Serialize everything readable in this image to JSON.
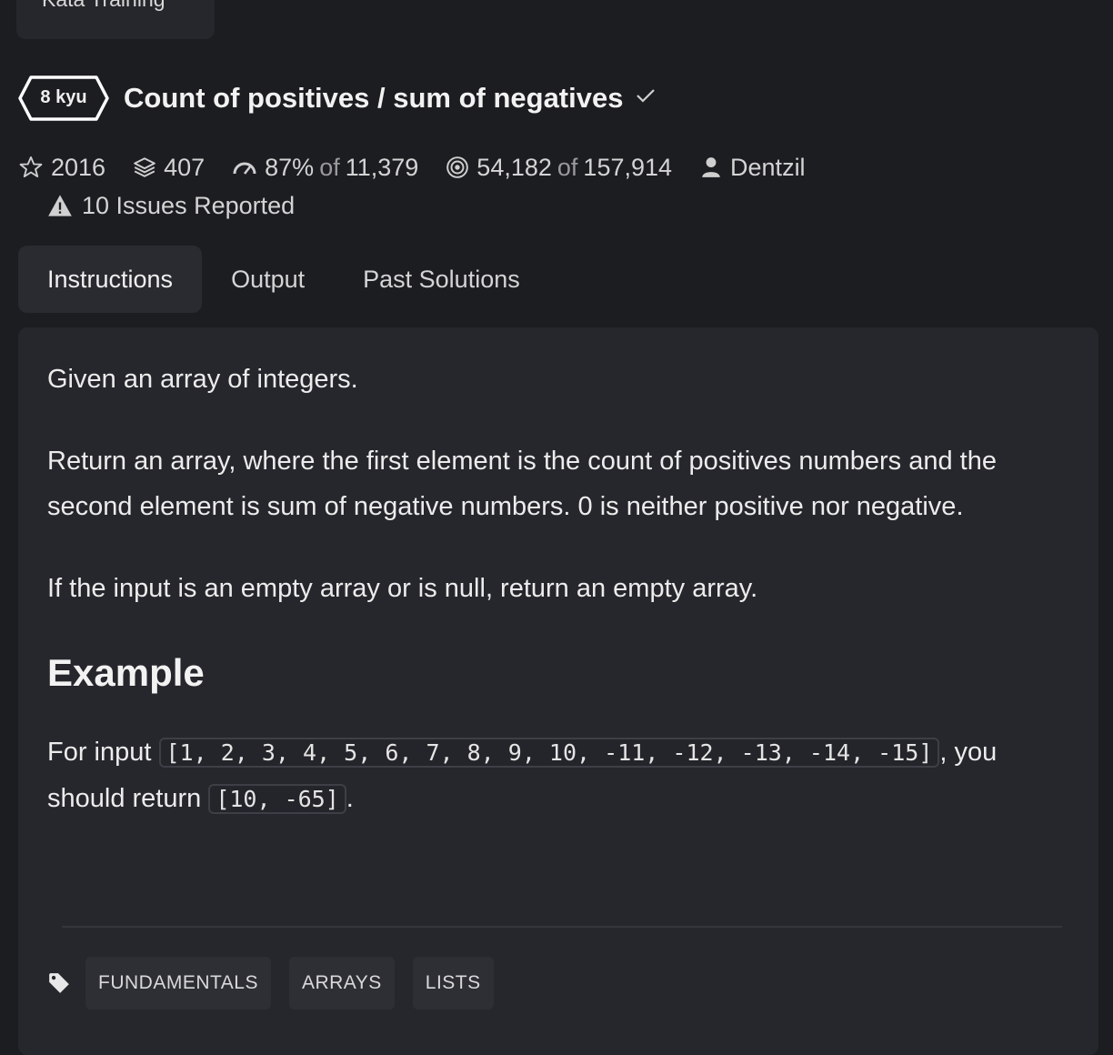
{
  "top_tab": {
    "label": "Kata Training"
  },
  "kata": {
    "rank": "8 kyu",
    "title": "Count of positives / sum of negatives"
  },
  "stats": {
    "stars": "2016",
    "collections": "407",
    "satisfaction_pct": "87%",
    "satisfaction_of_word": "of",
    "satisfaction_total": "11,379",
    "completed": "54,182",
    "completed_of_word": "of",
    "attempted": "157,914",
    "author": "Dentzil",
    "issues": "10 Issues Reported"
  },
  "tabs": [
    {
      "label": "Instructions",
      "active": true
    },
    {
      "label": "Output",
      "active": false
    },
    {
      "label": "Past Solutions",
      "active": false
    }
  ],
  "description": {
    "p1": "Given an array of integers.",
    "p2": "Return an array, where the first element is the count of positives numbers and the second element is sum of negative numbers. 0 is neither positive nor negative.",
    "p3": "If the input is an empty array or is null, return an empty array.",
    "heading": "Example",
    "example_prefix": "For input ",
    "example_input": "[1, 2, 3, 4, 5, 6, 7, 8, 9, 10, -11, -12, -13, -14, -15]",
    "example_middle": ", you should return ",
    "example_output": "[10, -65]",
    "example_suffix": "."
  },
  "tags": [
    "FUNDAMENTALS",
    "ARRAYS",
    "LISTS"
  ],
  "icons": {
    "star": "star-icon",
    "collections": "layers-icon",
    "satisfaction": "gauge-icon",
    "completed": "target-icon",
    "author": "user-icon",
    "issues": "warning-icon",
    "tags": "tag-icon",
    "check": "check-icon"
  },
  "colors": {
    "background": "#1c1d21",
    "panel": "#26272c",
    "active_tab": "#2a2b31",
    "badge_border": "#ffffff"
  }
}
